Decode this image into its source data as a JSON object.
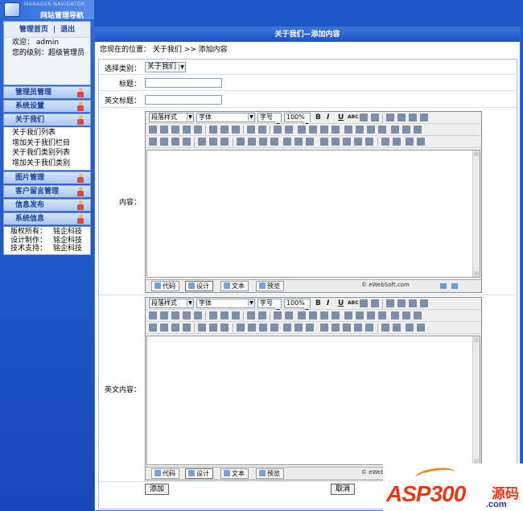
{
  "sidebar": {
    "header_small": "MANAGER NAVIGATOR",
    "header_title": "网站管理导航",
    "home_link": "管理首页",
    "link_sep": "|",
    "logout_link": "退出",
    "welcome": "欢迎： admin",
    "level": "您的级别：超级管理员",
    "menus": {
      "admin": "管理员管理",
      "settings": "系统设置",
      "about": "关于我们",
      "about_items": [
        "关于我们列表",
        "增加关于我们栏目",
        "关于我们类别列表",
        "增加关于我们类别"
      ],
      "images": "图片管理",
      "guestbook": "客户留言管理",
      "publish": "信息发布",
      "sysinfo": "系统信息"
    },
    "info": {
      "copyright_label": "版权所有：",
      "copyright_value": "铭企科技",
      "design_label": "设计制作：",
      "design_value": "铭企科技",
      "support_label": "技术支持：",
      "support_value": "铭企科技"
    }
  },
  "main": {
    "title": "关于我们—添加内容",
    "breadcrumb": "您现在的位置： 关于我们 >> 添加内容",
    "form": {
      "category_label": "选择类别：",
      "category_value": "关于我们",
      "title_label": "标题：",
      "title_en_label": "英文标题：",
      "content_label": "内容：",
      "content_en_label": "英文内容：",
      "add_button": "添加",
      "cancel_button": "取消"
    },
    "editor": {
      "style_select": "段落样式",
      "font_select": "字体",
      "size_select": "字号",
      "zoom_select": "100%",
      "bold": "B",
      "italic": "I",
      "underline": "U",
      "strike": "ABC",
      "tab_code": "代码",
      "tab_design": "设计",
      "tab_text": "文本",
      "tab_preview": "预览",
      "brand": "© eWebSoft.com"
    }
  },
  "watermark": {
    "brand": "ASP300",
    "cn": "源码",
    "domain": ".com"
  },
  "colors": {
    "sidebar_blue": "#1f56c6",
    "title_bar": "#2562d0",
    "menu_head": "#a9c5f0",
    "watermark_red": "#e23b19"
  }
}
